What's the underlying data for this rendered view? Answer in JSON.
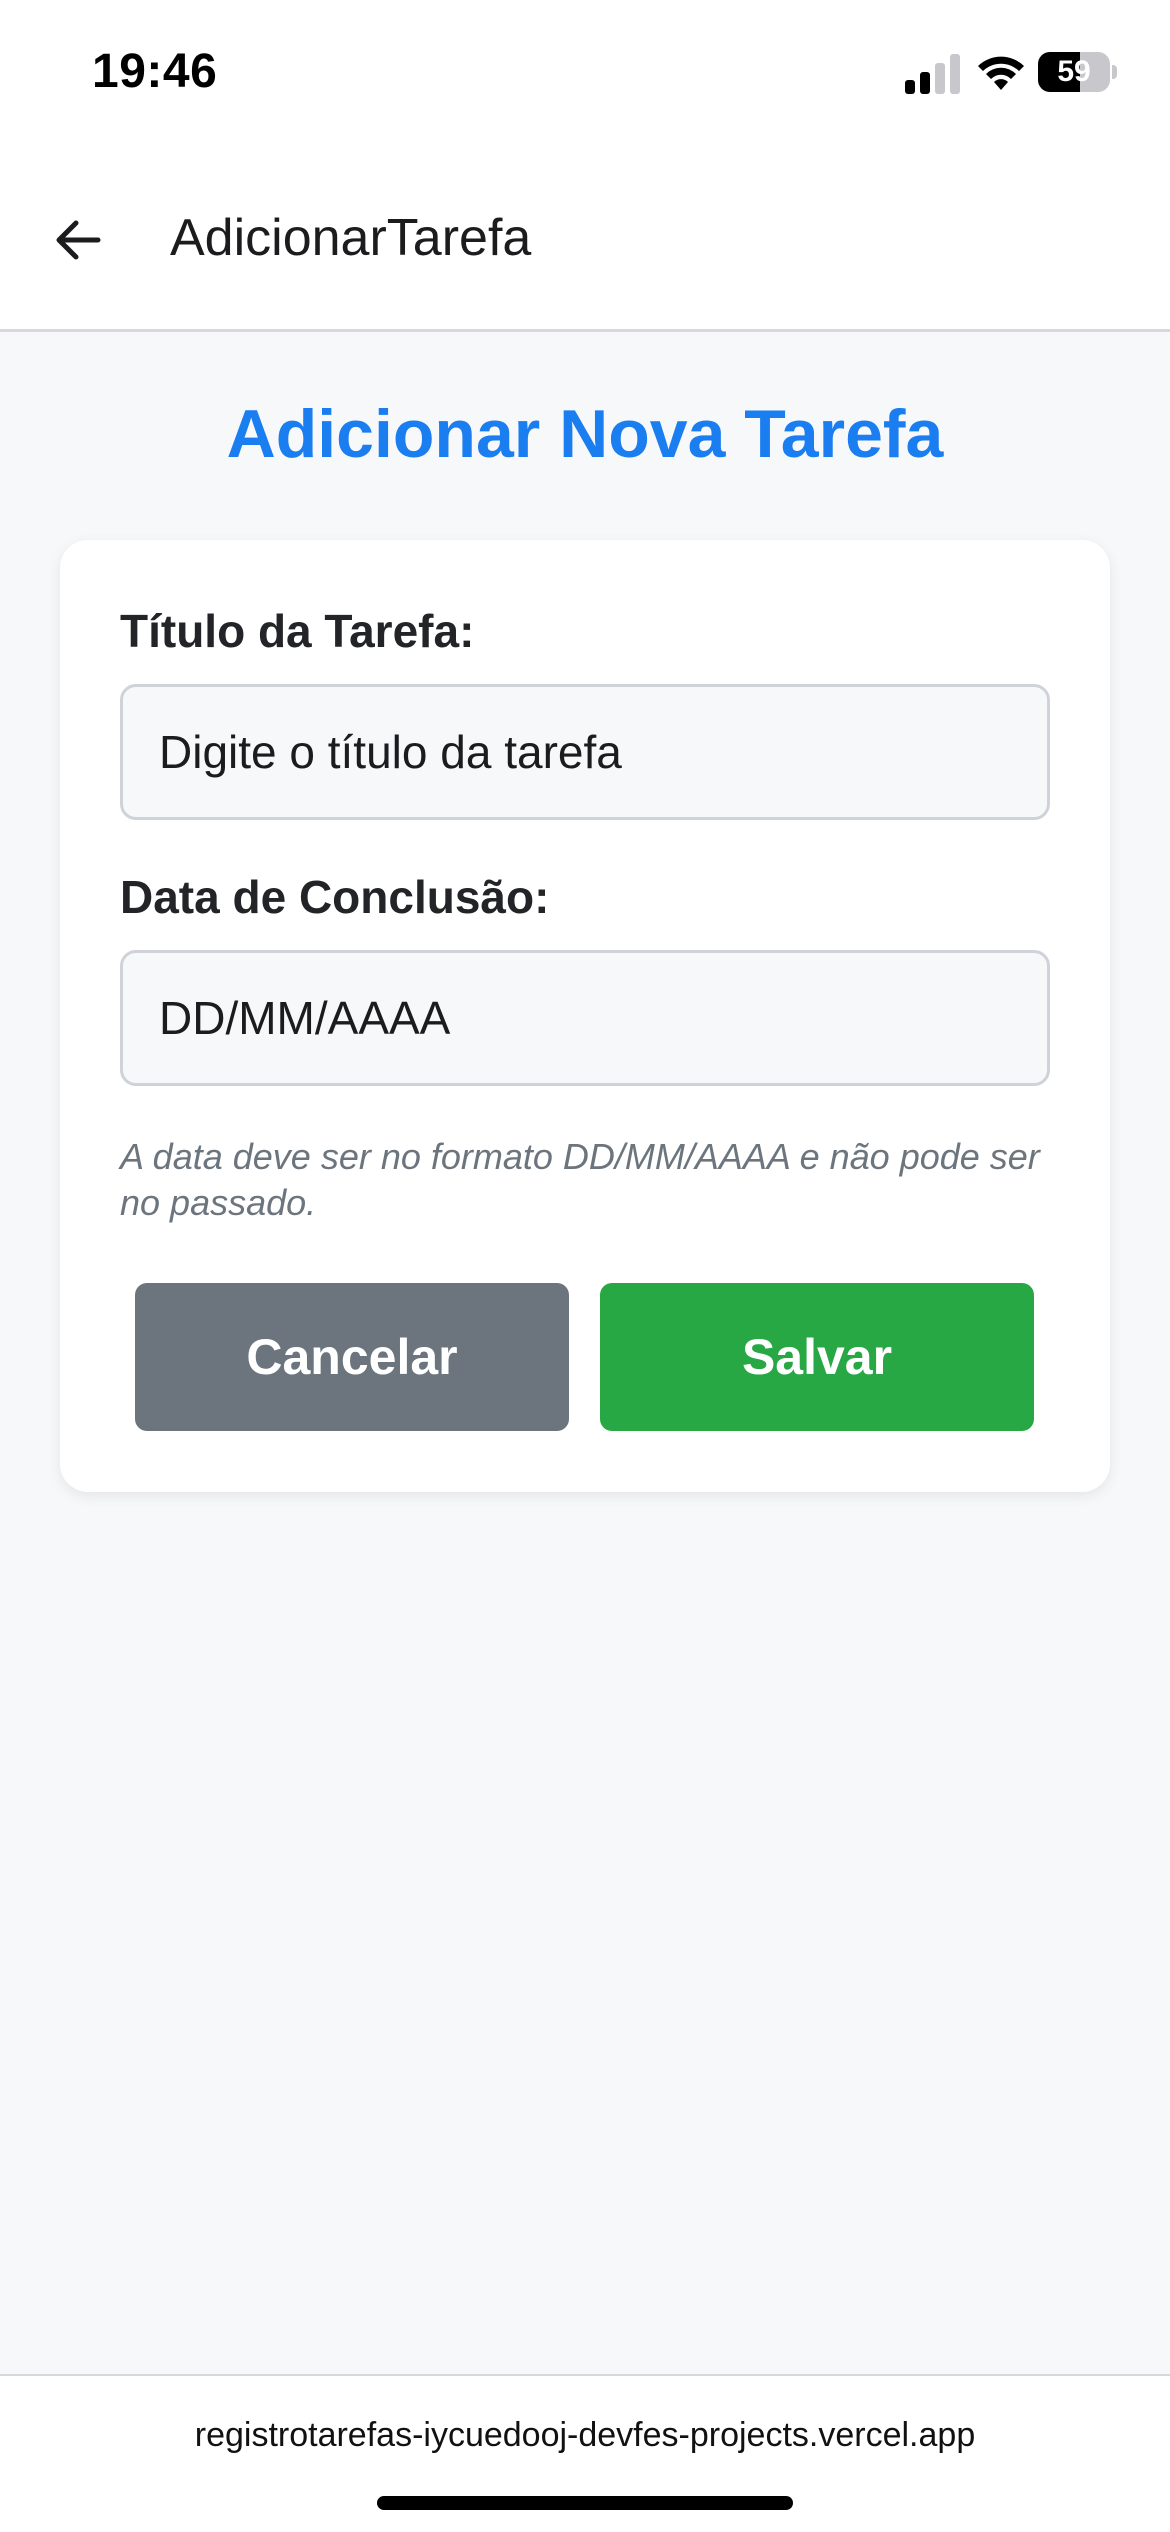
{
  "status_bar": {
    "time": "19:46",
    "battery_level": "59",
    "battery_fraction": 0.59,
    "icons": [
      "signal-icon",
      "wifi-icon",
      "battery-icon"
    ]
  },
  "header": {
    "back_icon": "arrow-left-icon",
    "title": "AdicionarTarefa"
  },
  "page": {
    "title": "Adicionar Nova Tarefa"
  },
  "form": {
    "title_label": "Título da Tarefa:",
    "title_input": {
      "value": "",
      "placeholder": "Digite o título da tarefa"
    },
    "date_label": "Data de Conclusão:",
    "date_input": {
      "value": "",
      "placeholder": "DD/MM/AAAA"
    },
    "hint": "A data deve ser no formato DD/MM/AAAA e não pode ser no passado.",
    "cancel_label": "Cancelar",
    "save_label": "Salvar"
  },
  "browser": {
    "url": "registrotarefas-iycuedooj-devfes-projects.vercel.app"
  },
  "colors": {
    "accent": "#1a7df0",
    "cancel": "#6c757d",
    "save": "#28a745"
  }
}
